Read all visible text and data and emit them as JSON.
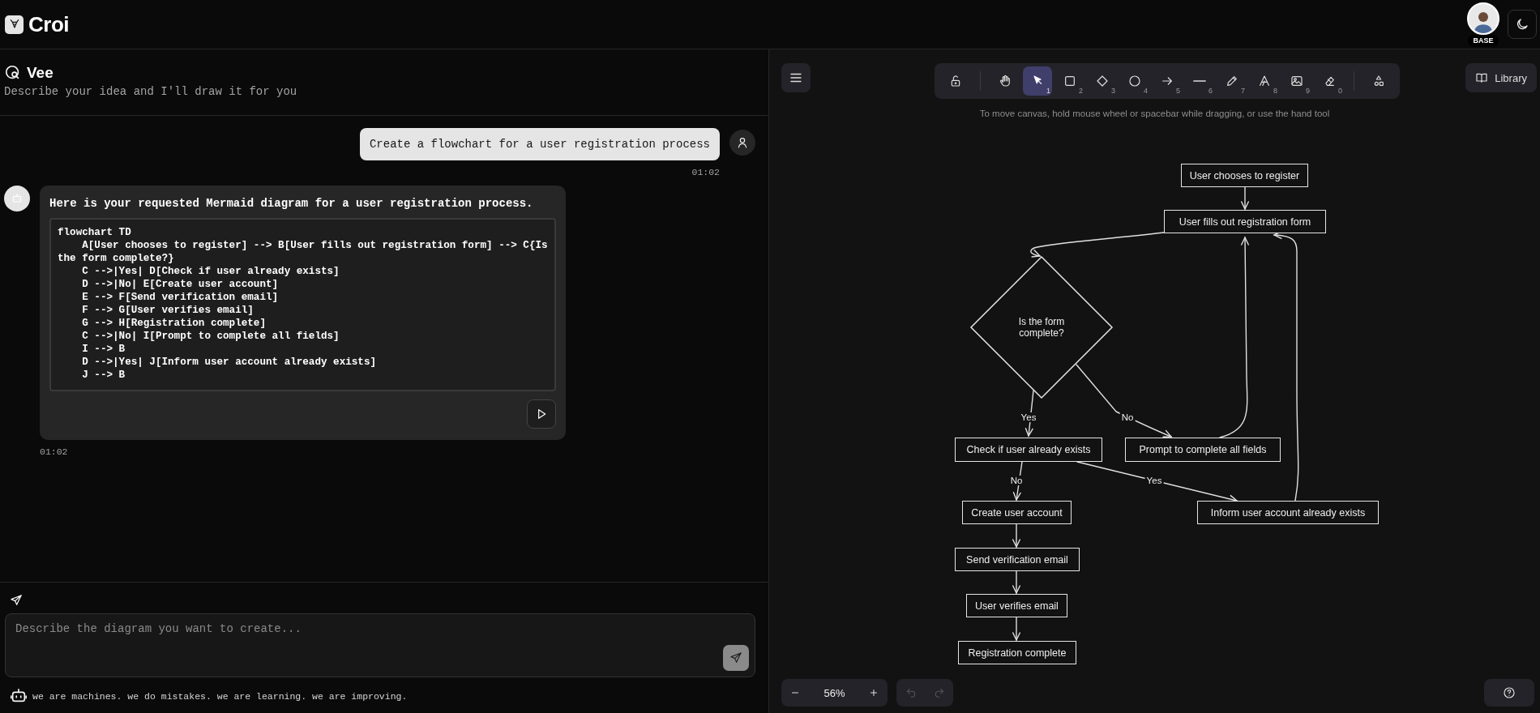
{
  "header": {
    "brand": "Croi",
    "avatar_badge": "BASE"
  },
  "chat": {
    "title": "Vee",
    "subtitle": "Describe your idea and I'll draw it for you",
    "messages": [
      {
        "kind": "user",
        "text": "Create a flowchart for a user registration process",
        "time": "01:02"
      },
      {
        "kind": "assistant",
        "text": "Here is your requested Mermaid diagram for a user registration process.",
        "code": "flowchart TD\n    A[User chooses to register] --> B[User fills out registration form] --> C{Is the form complete?}\n    C -->|Yes| D[Check if user already exists]\n    D -->|No| E[Create user account]\n    E --> F[Send verification email]\n    F --> G[User verifies email]\n    G --> H[Registration complete]\n    C -->|No| I[Prompt to complete all fields]\n    I --> B\n    D -->|Yes| J[Inform user account already exists]\n    J --> B",
        "time": "01:02"
      }
    ],
    "input": {
      "placeholder": "Describe the diagram you want to create..."
    },
    "disclaimer": "we are machines. we do mistakes. we are learning. we are improving."
  },
  "canvas": {
    "toolbar": [
      {
        "selected": false
      },
      {
        "selected": false
      },
      {
        "key": "1",
        "selected": true
      },
      {
        "key": "2",
        "selected": false
      },
      {
        "key": "3",
        "selected": false
      },
      {
        "key": "4",
        "selected": false
      },
      {
        "key": "5",
        "selected": false
      },
      {
        "key": "6",
        "selected": false
      },
      {
        "key": "7",
        "selected": false
      },
      {
        "key": "8",
        "selected": false
      },
      {
        "key": "9",
        "selected": false
      },
      {
        "key": "0",
        "selected": false
      },
      {
        "selected": false
      }
    ],
    "library_button": "Library",
    "hint": "To move canvas, hold mouse wheel or spacebar while dragging, or use the hand tool",
    "nodes": [
      {
        "kind": "process",
        "text": "User chooses to register"
      },
      {
        "kind": "process",
        "text": "User fills out registration form"
      },
      {
        "kind": "decision",
        "text": "Is the form complete?"
      },
      {
        "kind": "process",
        "text": "Check if user already exists"
      },
      {
        "kind": "process",
        "text": "Prompt to complete all fields"
      },
      {
        "kind": "process",
        "text": "Create user account"
      },
      {
        "kind": "process",
        "text": "Inform user account already exists"
      },
      {
        "kind": "process",
        "text": "Send verification email"
      },
      {
        "kind": "process",
        "text": "User verifies email"
      },
      {
        "kind": "process",
        "text": "Registration complete"
      }
    ],
    "edge_labels": [
      "Yes",
      "No",
      "No",
      "Yes"
    ],
    "zoom": "56%",
    "undo_disabled": true,
    "redo_disabled": true
  }
}
